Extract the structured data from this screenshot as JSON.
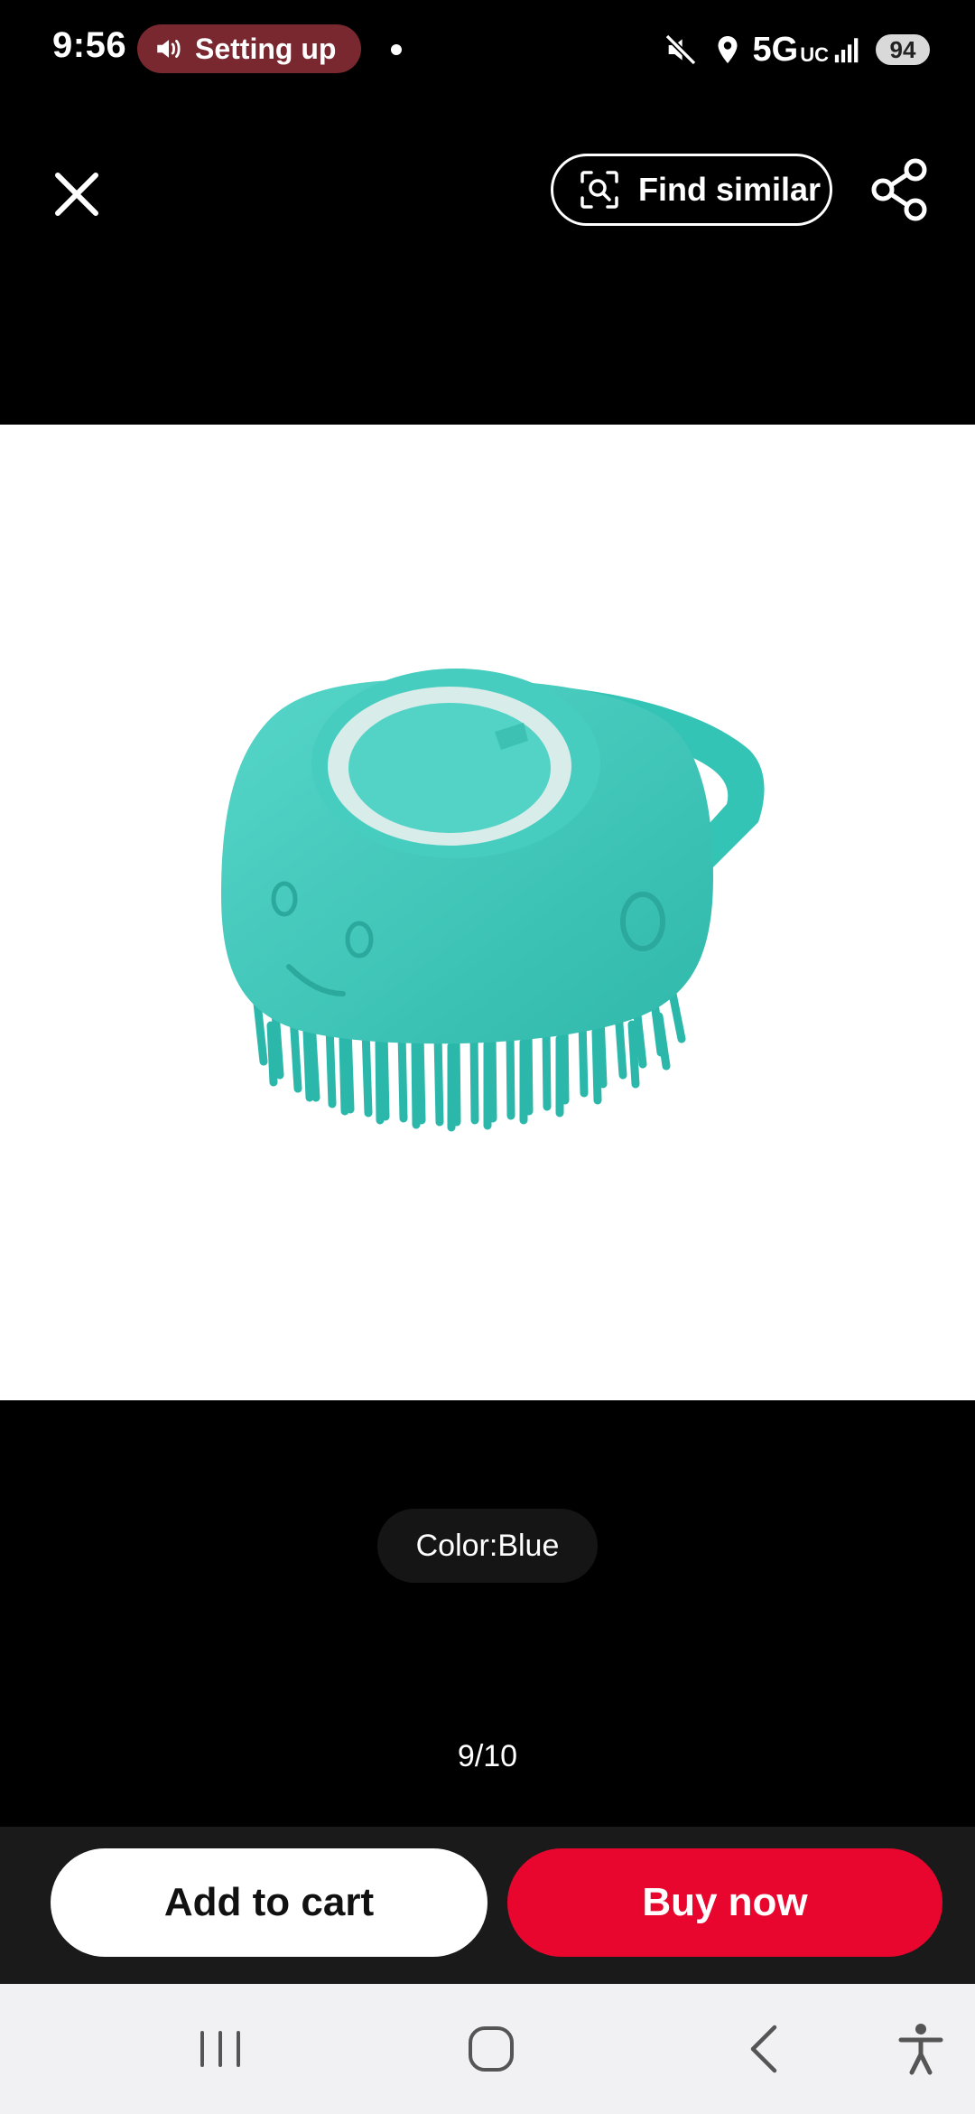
{
  "status_bar": {
    "time": "9:56",
    "pill_label": "Setting up",
    "network": "5G",
    "network_sub": "UC",
    "battery": "94",
    "icons": [
      "speaker-icon",
      "mute-icon",
      "location-icon",
      "signal-icon"
    ]
  },
  "top_bar": {
    "find_similar_label": "Find similar",
    "icons": [
      "close-icon",
      "image-search-icon",
      "share-icon"
    ]
  },
  "product": {
    "variant_label": "Color:Blue",
    "page_counter": "9/10"
  },
  "actions": {
    "add_to_cart_label": "Add to cart",
    "buy_now_label": "Buy now"
  },
  "nav_bar": {
    "icons": [
      "recents-icon",
      "home-icon",
      "back-icon",
      "accessibility-icon"
    ]
  },
  "colors": {
    "buy_now": "#e8062f",
    "product_teal": "#3fc9bb",
    "status_pill": "#7a2830"
  }
}
